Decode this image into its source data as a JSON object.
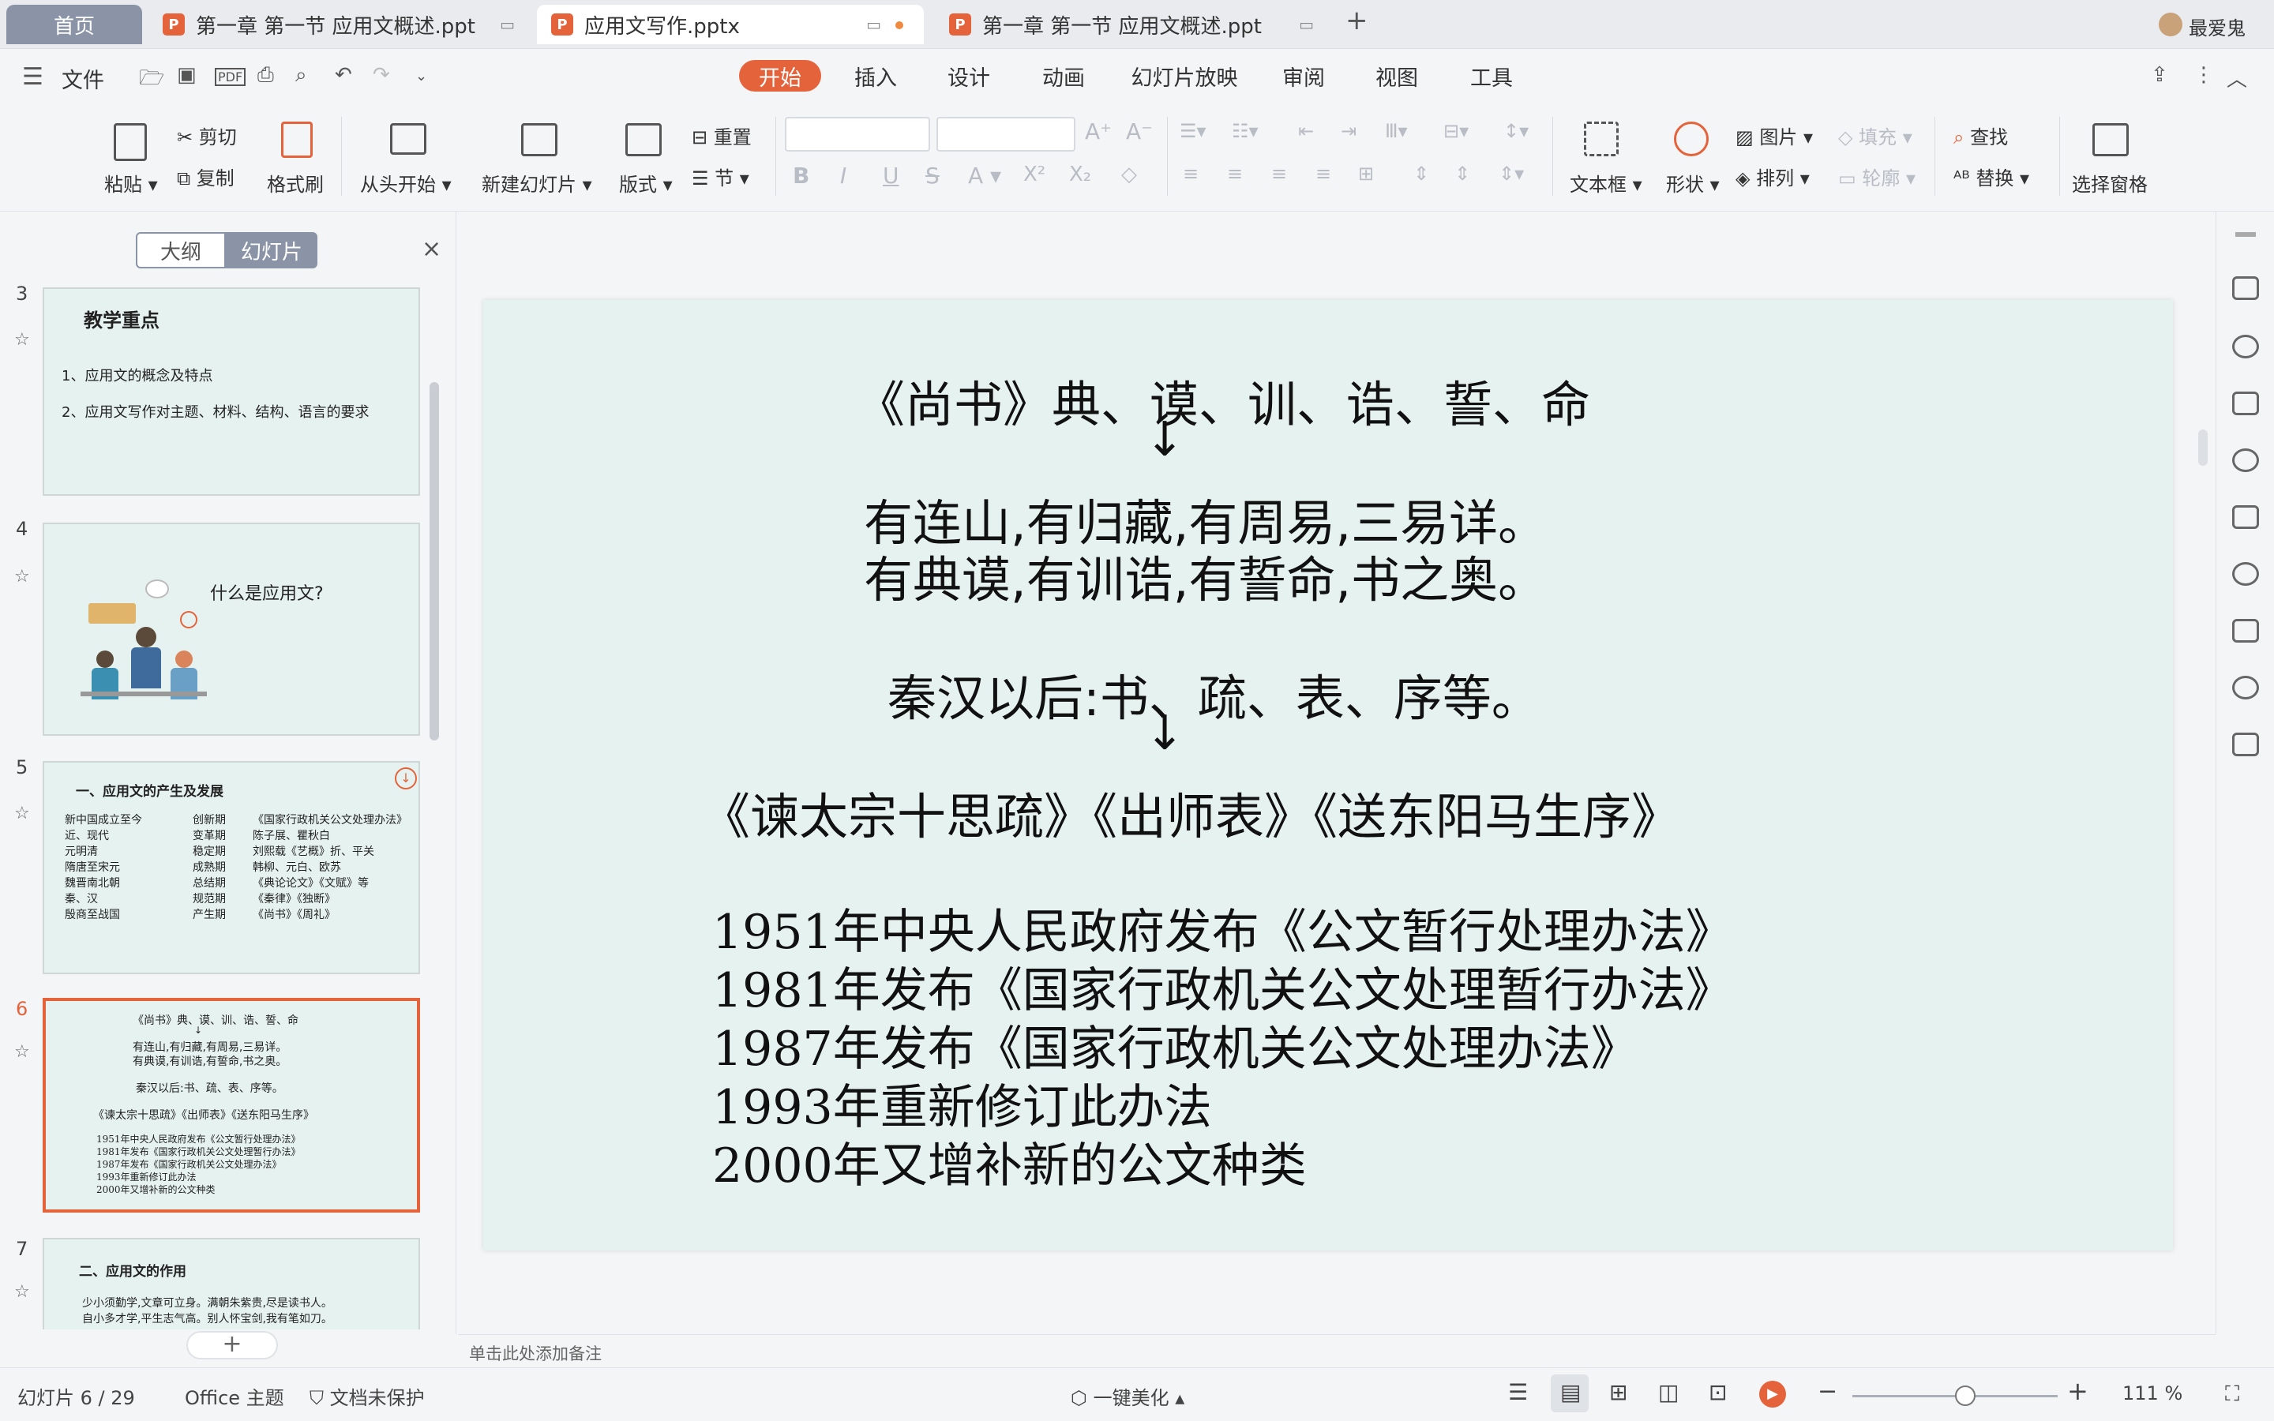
{
  "tabs": {
    "home": "首页",
    "doc1": "第一章 第一节 应用文概述.ppt",
    "doc2": "应用文写作.pptx",
    "doc3": "第一章 第一节 应用文概述.ppt",
    "add": "+",
    "user": "最爱鬼"
  },
  "menubar": {
    "file": "文件",
    "items": [
      "开始",
      "插入",
      "设计",
      "动画",
      "幻灯片放映",
      "审阅",
      "视图",
      "工具"
    ]
  },
  "ribbon": {
    "paste": "粘贴",
    "cut": "剪切",
    "copy": "复制",
    "format_painter": "格式刷",
    "from_start": "从头开始",
    "new_slide": "新建幻灯片",
    "layout": "版式",
    "reset": "重置",
    "section": "节",
    "textbox": "文本框",
    "shape": "形状",
    "picture": "图片",
    "fill": "填充",
    "arrange": "排列",
    "outline": "轮廓",
    "find": "查找",
    "replace": "替换",
    "selection_pane": "选择窗格"
  },
  "left_panel": {
    "outline_tab": "大纲",
    "slides_tab": "幻灯片",
    "close": "×",
    "add": "+",
    "thumbs": [
      {
        "num": "3",
        "title": "教学重点",
        "lines": [
          "1、应用文的概念及特点",
          "2、应用文写作对主题、材料、结构、语言的要求"
        ]
      },
      {
        "num": "4",
        "title": "什么是应用文?"
      },
      {
        "num": "5",
        "title": "一、应用文的产生及发展",
        "rows": [
          [
            "新中国成立至今",
            "创新期",
            "《国家行政机关公文处理办法》"
          ],
          [
            "近、现代",
            "变革期",
            "陈子展、瞿秋白"
          ],
          [
            "元明清",
            "稳定期",
            "刘熙载《艺概》折、平关"
          ],
          [
            "隋唐至宋元",
            "成熟期",
            "韩柳、元白、欧苏"
          ],
          [
            "魏晋南北朝",
            "总结期",
            "《典论论文》《文赋》等"
          ],
          [
            "秦、汉",
            "规范期",
            "《秦律》《独断》"
          ],
          [
            "殷商至战国",
            "产生期",
            "《尚书》《周礼》"
          ]
        ]
      },
      {
        "num": "6"
      },
      {
        "num": "7",
        "title": "二、应用文的作用",
        "lines": [
          "少小须勤学,文章可立身。满朝朱紫贵,尽是读书人。",
          "自小多才学,平生志气高。别人怀宝剑,我有笔如刀。"
        ]
      }
    ]
  },
  "slide": {
    "line1": "《尚书》典、谟、训、诰、誓、命",
    "arrow": "↓",
    "line2": "有连山,有归藏,有周易,三易详。",
    "line3": "有典谟,有训诰,有誓命,书之奥。",
    "line4": "秦汉以后:书、疏、表、序等。",
    "line5": "《谏太宗十思疏》《出师表》《送东阳马生序》",
    "history": [
      "1951年中央人民政府发布《公文暂行处理办法》",
      "1981年发布《国家行政机关公文处理暂行办法》",
      "1987年发布《国家行政机关公文处理办法》",
      "1993年重新修订此办法",
      "2000年又增补新的公文种类"
    ]
  },
  "notes_placeholder": "单击此处添加备注",
  "status": {
    "slide_counter": "幻灯片 6 / 29",
    "theme": "Office 主题",
    "protect": "文档未保护",
    "beautify": "一键美化",
    "zoom": "111 %",
    "zoom_level": 0.55
  },
  "colors": {
    "accent": "#e4633b",
    "slide_bg": "#e6f2f0",
    "home_tab": "#8a94a6"
  }
}
